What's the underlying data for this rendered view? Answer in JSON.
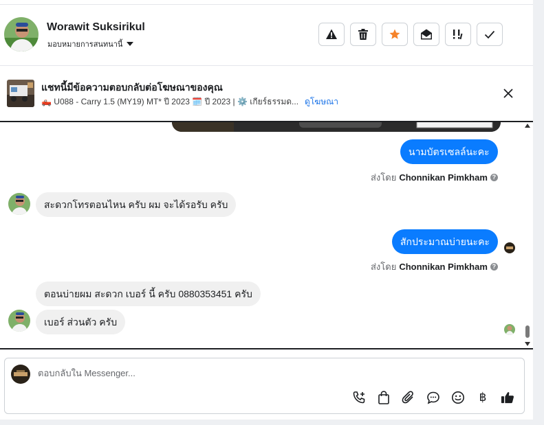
{
  "header": {
    "contact_name": "Worawit Suksirikul",
    "assign_label": "มอบหมายการสนทนานี้",
    "actions": [
      {
        "icon": "warning-icon"
      },
      {
        "icon": "trash-icon"
      },
      {
        "icon": "star-icon",
        "color": "#f5832a"
      },
      {
        "icon": "envelope-open-icon"
      },
      {
        "icon": "priority-icon"
      },
      {
        "icon": "check-icon"
      }
    ]
  },
  "ad_banner": {
    "title": "แชทนี้มีข้อความตอบกลับต่อโฆษณาของคุณ",
    "subtitle": "🛻 U088 - Carry 1.5 (MY19) MT* ปี 2023 🗓️ ปี 2023 | ⚙️ เกียร์ธรรมด...",
    "view_ad_label": "ดูโฆษณา"
  },
  "messages": [
    {
      "direction": "out",
      "text": "นามบัตรเซลล์นะคะ",
      "sent_by_prefix": "ส่งโดย",
      "sent_by_name": "Chonnikan Pimkham"
    },
    {
      "direction": "in",
      "text": "สะดวกโทรตอนไหน ครับ ผม จะได้รอรับ ครับ"
    },
    {
      "direction": "out",
      "text": "สักประมาณบ่ายนะคะ",
      "sent_by_prefix": "ส่งโดย",
      "sent_by_name": "Chonnikan Pimkham"
    },
    {
      "direction": "in",
      "text": "ตอนบ่ายผม สะดวก เบอร์ นี้ ครับ  0880353451 ครับ"
    },
    {
      "direction": "in",
      "text": "เบอร์ ส่วนตัว ครับ"
    }
  ],
  "composer": {
    "placeholder": "ตอบกลับใน Messenger...",
    "tools": [
      "call-add-icon",
      "shopping-bag-icon",
      "paperclip-icon",
      "chat-bubble-icon",
      "emoji-icon",
      "baht-icon",
      "thumbs-up-icon"
    ],
    "baht_symbol": "฿"
  },
  "colors": {
    "accent": "#0a7cff",
    "incoming_bubble": "#f0f0f0",
    "star": "#f5832a",
    "link": "#1a73e8"
  }
}
